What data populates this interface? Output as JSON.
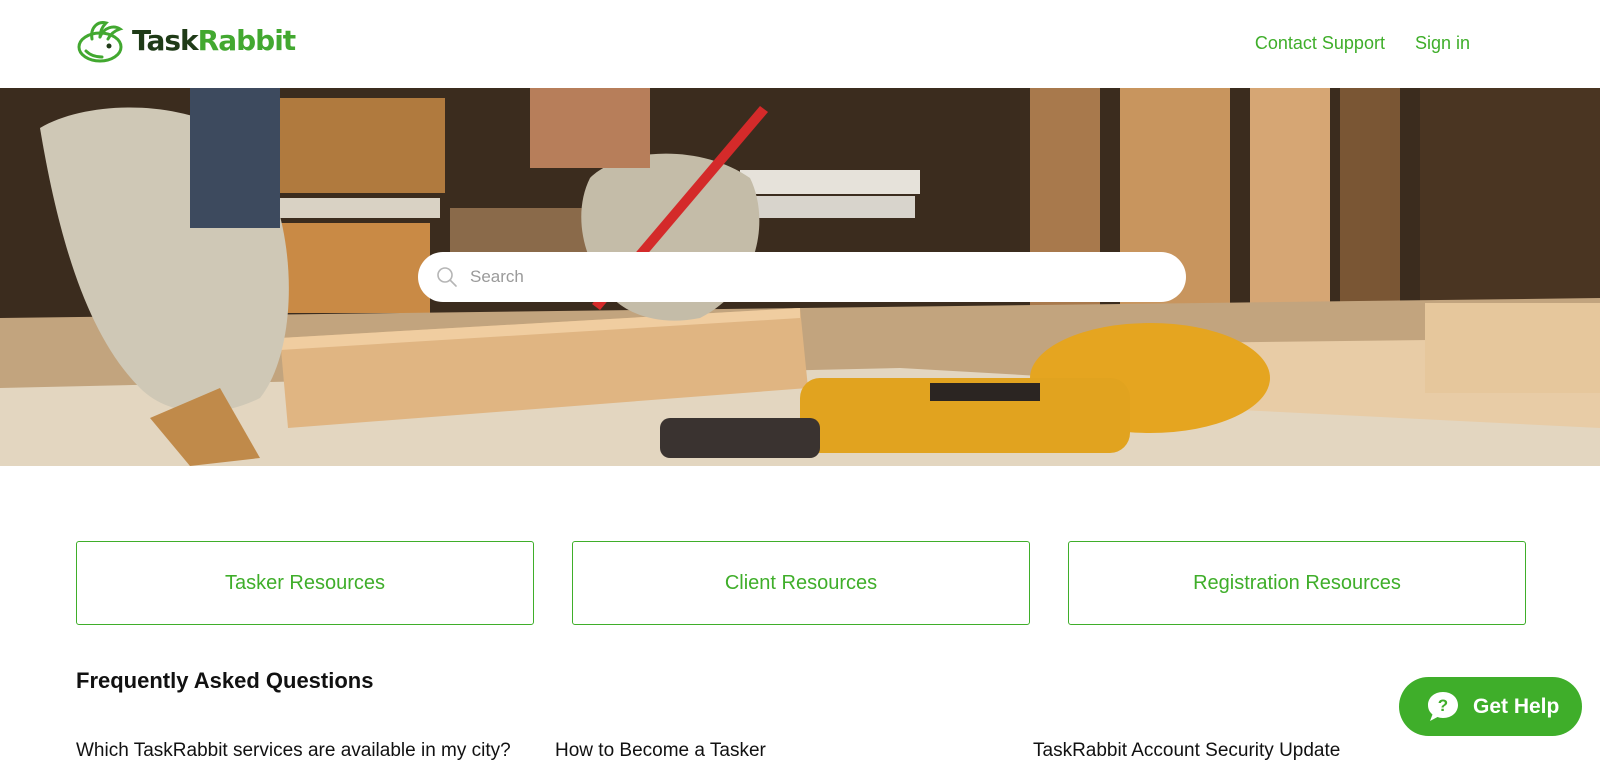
{
  "header": {
    "logo": {
      "task": "Task",
      "rabbit": "Rabbit"
    },
    "nav": {
      "contact_support": "Contact Support",
      "sign_in": "Sign in"
    }
  },
  "hero": {
    "search": {
      "placeholder": "Search",
      "icon": "search-icon"
    }
  },
  "resources": {
    "cards": [
      "Tasker Resources",
      "Client Resources",
      "Registration Resources"
    ]
  },
  "faq": {
    "title": "Frequently Asked Questions",
    "items": [
      "Which TaskRabbit services are available in my city?",
      "How to Become a Tasker",
      "TaskRabbit Account Security Update"
    ]
  },
  "help_widget": {
    "label": "Get Help",
    "icon": "question-bubble-icon"
  },
  "colors": {
    "brand_green": "#3fae2a",
    "brand_dark": "#1f3b17"
  }
}
